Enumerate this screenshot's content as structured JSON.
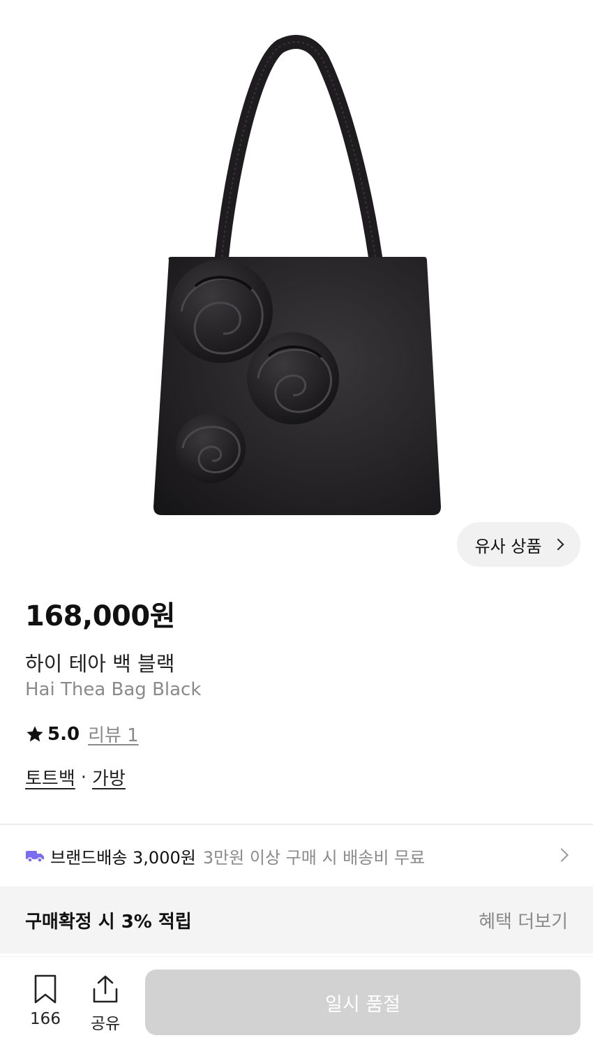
{
  "product": {
    "image_icon": "black-satin-tote-bag-with-three-rosettes",
    "similar_button_label": "유사 상품",
    "price": "168,000원",
    "name_ko": "하이 테아 백 블랙",
    "name_en": "Hai Thea Bag Black",
    "rating": "5.0",
    "review_link": "리뷰 1",
    "categories": [
      "토트백",
      "가방"
    ],
    "category_separator": "·"
  },
  "shipping": {
    "icon": "truck-icon",
    "label": "브랜드배송 3,000원",
    "note": "3만원 이상 구매 시 배송비 무료"
  },
  "points": {
    "text": "구매확정 시 3% 적립",
    "more_link": "혜택 더보기"
  },
  "bottom_bar": {
    "bookmark_count": "166",
    "share_label": "공유",
    "soldout_label": "일시 품절"
  },
  "colors": {
    "truck_icon": "#7b6cf0",
    "soldout_button": "#d2d2d2"
  }
}
